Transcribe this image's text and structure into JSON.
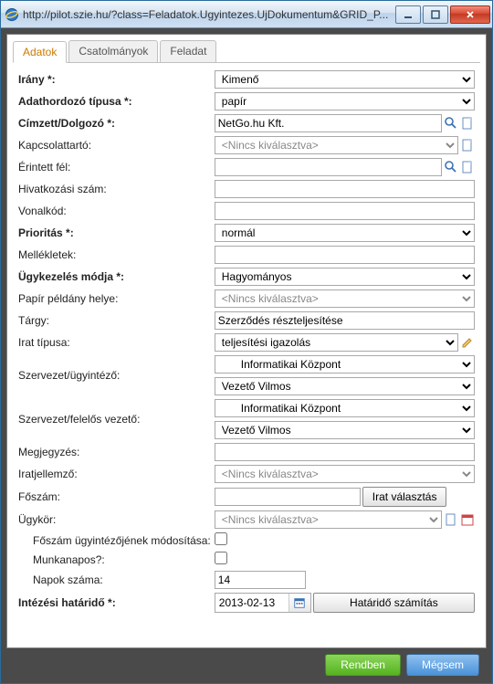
{
  "window": {
    "url": "http://pilot.szie.hu/?class=Feladatok.Ugyintezes.UjDokumentum&GRID_P..."
  },
  "tabs": {
    "items": [
      "Adatok",
      "Csatolmányok",
      "Feladat"
    ],
    "active_index": 0
  },
  "labels": {
    "irany": "Irány *:",
    "adathordozo": "Adathordozó típusa *:",
    "cimzett": "Címzett/Dolgozó *:",
    "kapcsolattarto": "Kapcsolattartó:",
    "erintett": "Érintett fél:",
    "hivatkozasi": "Hivatkozási szám:",
    "vonalkod": "Vonalkód:",
    "prioritas": "Prioritás *:",
    "mellekletek": "Mellékletek:",
    "ugykezeles": "Ügykezelés módja *:",
    "papir_helye": "Papír példány helye:",
    "targy": "Tárgy:",
    "irat_tipusa": "Irat típusa:",
    "szervezet_ugy": "Szervezet/ügyintéző:",
    "szervezet_fel": "Szervezet/felelős vezető:",
    "megjegyzes": "Megjegyzés:",
    "iratjellemzo": "Iratjellemző:",
    "foszam": "Főszám:",
    "ugykor": "Ügykör:",
    "foszam_mod": "Főszám ügyintézőjének módosítása:",
    "munkanapos": "Munkanapos?:",
    "napok": "Napok száma:",
    "hatarido": "Intézési határidő *:"
  },
  "values": {
    "irany": "Kimenő",
    "adathordozo": "papír",
    "cimzett": "NetGo.hu Kft.",
    "kapcsolattarto_placeholder": "<Nincs kiválasztva>",
    "erintett": "",
    "hivatkozasi": "",
    "vonalkod": "",
    "prioritas": "normál",
    "mellekletek": "",
    "ugykezeles": "Hagyományos",
    "papir_helye": "<Nincs kiválasztva>",
    "targy": "Szerződés részteljesítése",
    "irat_tipusa": "teljesítési igazolás",
    "szervezet_ugy_org": "Informatikai Központ",
    "szervezet_ugy_person": "Vezető Vilmos",
    "szervezet_fel_org": "Informatikai Központ",
    "szervezet_fel_person": "Vezető Vilmos",
    "megjegyzes": "",
    "iratjellemzo": "<Nincs kiválasztva>",
    "foszam": "",
    "ugykor": "<Nincs kiválasztva>",
    "foszam_mod": false,
    "munkanapos": false,
    "napok": "14",
    "hatarido": "2013-02-13"
  },
  "buttons": {
    "irat_valasztas": "Irat választás",
    "hatarido_szamitas": "Határidő számítás",
    "ok": "Rendben",
    "cancel": "Mégsem"
  }
}
